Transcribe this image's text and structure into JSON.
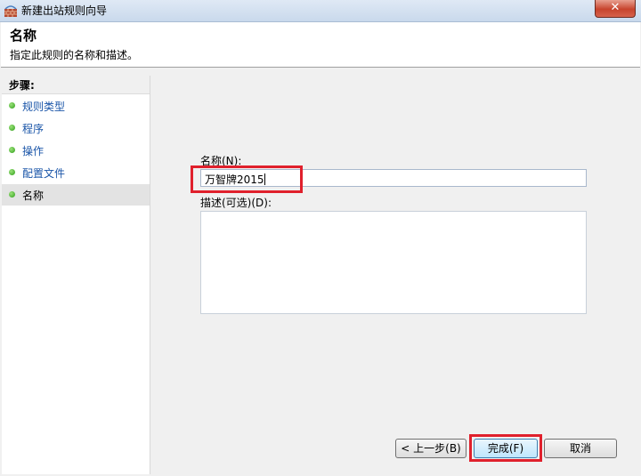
{
  "window": {
    "title": "新建出站规则向导",
    "close_glyph": "✕"
  },
  "header": {
    "title": "名称",
    "description": "指定此规则的名称和描述。"
  },
  "steps": {
    "heading": "步骤:",
    "items": [
      {
        "label": "规则类型",
        "current": false
      },
      {
        "label": "程序",
        "current": false
      },
      {
        "label": "操作",
        "current": false
      },
      {
        "label": "配置文件",
        "current": false
      },
      {
        "label": "名称",
        "current": true
      }
    ]
  },
  "form": {
    "name_label": "名称(N):",
    "name_value": "万智牌2015",
    "desc_label": "描述(可选)(D):",
    "desc_value": ""
  },
  "buttons": {
    "back": "< 上一步(B)",
    "finish": "完成(F)",
    "cancel": "取消"
  },
  "colors": {
    "highlight": "#e0202c",
    "step_link": "#1a55a8",
    "step_dot": "#2f9e1a"
  }
}
